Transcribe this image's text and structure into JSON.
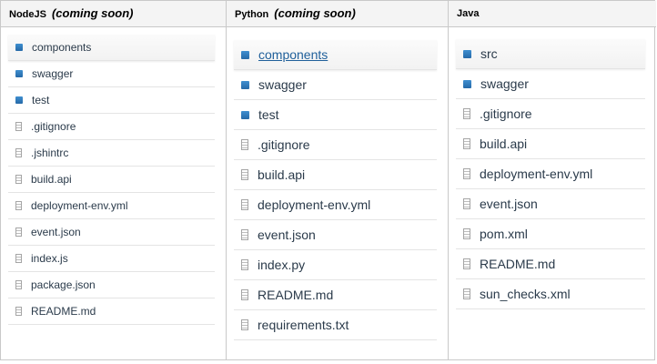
{
  "columns": [
    {
      "title": "NodeJS",
      "status": "(coming soon)",
      "items": [
        {
          "label": "components",
          "type": "folder",
          "icon": "folder-icon"
        },
        {
          "label": "swagger",
          "type": "folder",
          "icon": "folder-icon"
        },
        {
          "label": "test",
          "type": "folder",
          "icon": "folder-icon"
        },
        {
          "label": ".gitignore",
          "type": "file",
          "icon": "file-icon"
        },
        {
          "label": ".jshintrc",
          "type": "file",
          "icon": "file-icon"
        },
        {
          "label": "build.api",
          "type": "file",
          "icon": "file-icon"
        },
        {
          "label": "deployment-env.yml",
          "type": "file",
          "icon": "file-icon"
        },
        {
          "label": "event.json",
          "type": "file",
          "icon": "file-icon"
        },
        {
          "label": "index.js",
          "type": "file",
          "icon": "file-icon"
        },
        {
          "label": "package.json",
          "type": "file",
          "icon": "file-icon"
        },
        {
          "label": "README.md",
          "type": "file",
          "icon": "file-icon"
        }
      ]
    },
    {
      "title": "Python",
      "status": "(coming soon)",
      "items": [
        {
          "label": "components",
          "type": "folder",
          "icon": "folder-icon"
        },
        {
          "label": "swagger",
          "type": "folder",
          "icon": "folder-icon"
        },
        {
          "label": "test",
          "type": "folder",
          "icon": "folder-icon"
        },
        {
          "label": ".gitignore",
          "type": "file",
          "icon": "file-icon"
        },
        {
          "label": "build.api",
          "type": "file",
          "icon": "file-icon"
        },
        {
          "label": "deployment-env.yml",
          "type": "file",
          "icon": "file-icon"
        },
        {
          "label": "event.json",
          "type": "file",
          "icon": "file-icon"
        },
        {
          "label": "index.py",
          "type": "file",
          "icon": "file-icon"
        },
        {
          "label": "README.md",
          "type": "file",
          "icon": "file-icon"
        },
        {
          "label": "requirements.txt",
          "type": "file",
          "icon": "file-icon"
        }
      ]
    },
    {
      "title": "Java",
      "status": "",
      "items": [
        {
          "label": "src",
          "type": "folder",
          "icon": "folder-icon"
        },
        {
          "label": "swagger",
          "type": "folder",
          "icon": "folder-icon"
        },
        {
          "label": ".gitignore",
          "type": "file",
          "icon": "file-icon"
        },
        {
          "label": "build.api",
          "type": "file",
          "icon": "file-icon"
        },
        {
          "label": "deployment-env.yml",
          "type": "file",
          "icon": "file-icon"
        },
        {
          "label": "event.json",
          "type": "file",
          "icon": "file-icon"
        },
        {
          "label": "pom.xml",
          "type": "file",
          "icon": "file-icon"
        },
        {
          "label": "README.md",
          "type": "file",
          "icon": "file-icon"
        },
        {
          "label": "sun_checks.xml",
          "type": "file",
          "icon": "file-icon"
        }
      ]
    }
  ],
  "colors": {
    "folder": "#2f7cc0",
    "link": "#1f5f9a",
    "text": "#2a3a4a",
    "border": "#c9c9c9",
    "header_bg": "#f4f4f4"
  }
}
